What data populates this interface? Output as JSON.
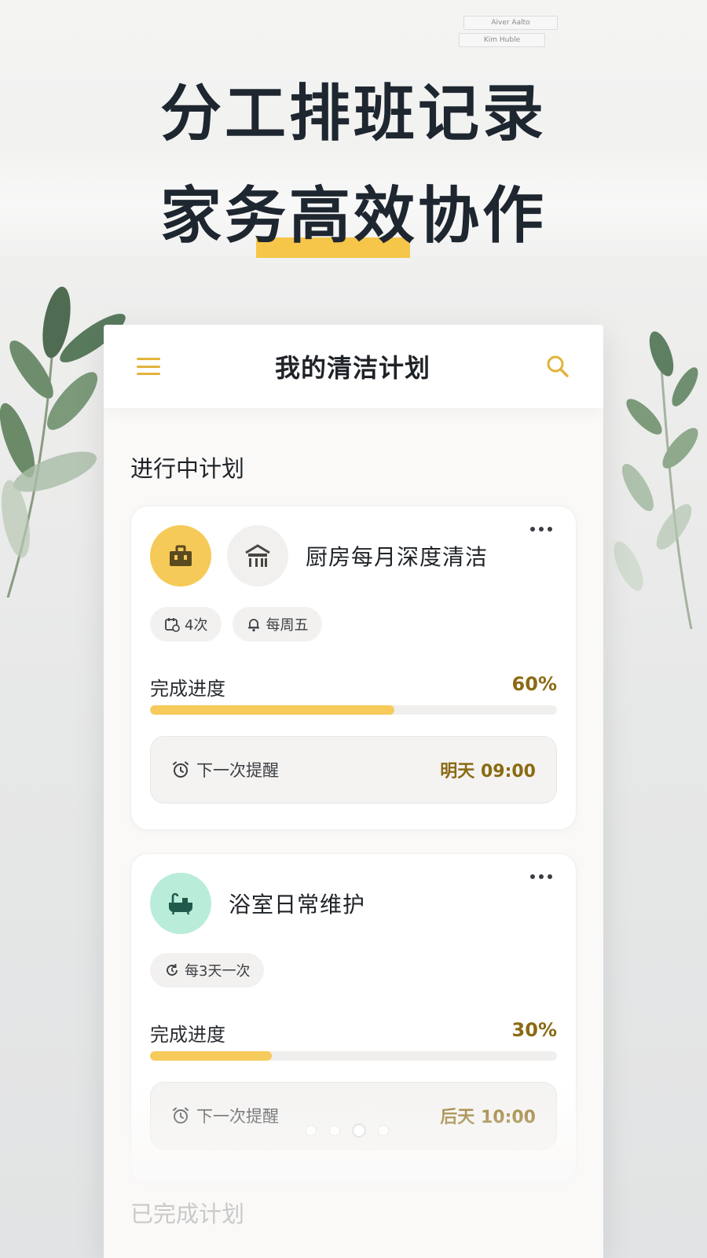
{
  "hero": {
    "line1": "分工排班记录",
    "line2": "家务高效协作",
    "highlight_color": "#f6c64a"
  },
  "backdrop": {
    "book_1": "Aiver Aalto",
    "book_2": "Kim Huble"
  },
  "app": {
    "title": "我的清洁计划",
    "menu_icon": "hamburger-menu-icon",
    "search_icon": "search-icon",
    "accent": "#e3b33b"
  },
  "sections": {
    "active": "进行中计划",
    "completed": "已完成计划"
  },
  "plans": [
    {
      "title": "厨房每月深度清洁",
      "icons": [
        "toolbox-icon",
        "kitchen-icon"
      ],
      "chips": [
        {
          "icon": "calendar-repeat-icon",
          "label": "4次"
        },
        {
          "icon": "bell-icon",
          "label": "每周五"
        }
      ],
      "progress_label": "完成进度",
      "progress_text": "60%",
      "progress": 0.6,
      "reminder_label": "下一次提醒",
      "reminder_time": "明天 09:00"
    },
    {
      "title": "浴室日常维护",
      "icons": [
        "bathtub-icon"
      ],
      "chips": [
        {
          "icon": "cycle-icon",
          "label": "每3天一次"
        }
      ],
      "progress_label": "完成进度",
      "progress_text": "30%",
      "progress": 0.3,
      "reminder_label": "下一次提醒",
      "reminder_time": "后天 10:00"
    }
  ],
  "pager": {
    "count": 4,
    "active_index": 2
  }
}
